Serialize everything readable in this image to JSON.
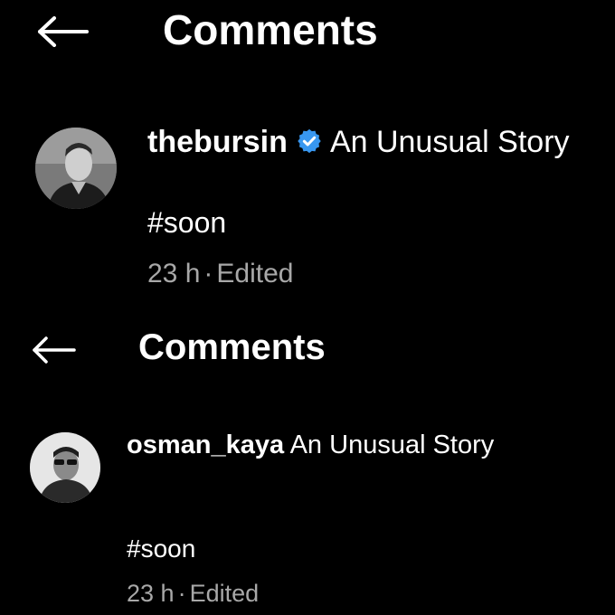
{
  "colors": {
    "background": "#000000",
    "text": "#ffffff",
    "meta_text": "#a8a8a8",
    "verified_badge": "#3897f0"
  },
  "panels": [
    {
      "header": {
        "back_icon": "arrow-left-icon",
        "title": "Comments"
      },
      "comment": {
        "avatar_icon": "profile-photo",
        "username": "thebursin",
        "verified": true,
        "verified_icon": "verified-badge-icon",
        "caption": "An Unusual Story",
        "body": "#soon",
        "time": "23 h",
        "separator": "·",
        "status": "Edited"
      }
    },
    {
      "header": {
        "back_icon": "arrow-left-icon",
        "title": "Comments"
      },
      "comment": {
        "avatar_icon": "profile-photo",
        "username": "osman_kaya",
        "verified": false,
        "caption": "An Unusual Story",
        "body": "#soon",
        "time": "23 h",
        "separator": "·",
        "status": "Edited"
      }
    }
  ]
}
